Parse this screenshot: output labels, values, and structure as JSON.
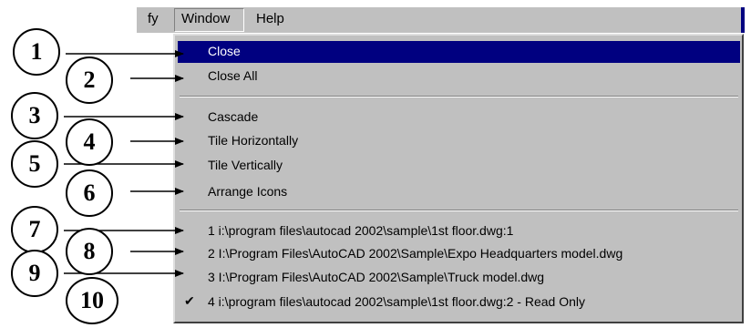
{
  "menubar": {
    "items": [
      {
        "label": "fy"
      },
      {
        "label": "Window",
        "selected": true
      },
      {
        "label": "Help"
      }
    ]
  },
  "menu": {
    "items": [
      {
        "label": "Close",
        "highlighted": true
      },
      {
        "label": "Close All"
      },
      {
        "label": "Cascade"
      },
      {
        "label": "Tile Horizontally"
      },
      {
        "label": "Tile Vertically"
      },
      {
        "label": "Arrange Icons"
      },
      {
        "label": "1 i:\\program files\\autocad 2002\\sample\\1st floor.dwg:1"
      },
      {
        "label": "2 I:\\Program Files\\AutoCAD 2002\\Sample\\Expo Headquarters model.dwg"
      },
      {
        "label": "3 I:\\Program Files\\AutoCAD 2002\\Sample\\Truck model.dwg"
      },
      {
        "label": "4 i:\\program files\\autocad 2002\\sample\\1st floor.dwg:2 - Read Only",
        "checked": true
      }
    ]
  },
  "callouts": [
    "1",
    "2",
    "3",
    "4",
    "5",
    "6",
    "7",
    "8",
    "9",
    "10"
  ],
  "colors": {
    "highlight": "#000080",
    "menu_bg": "#c0c0c0"
  }
}
